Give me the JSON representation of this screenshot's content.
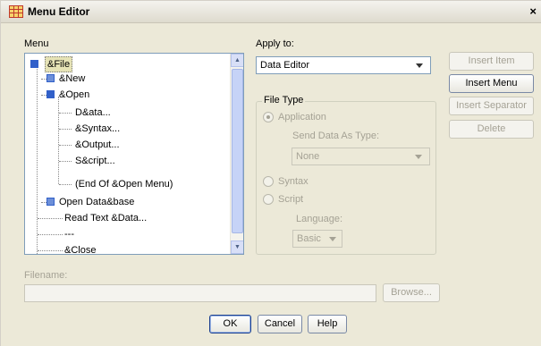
{
  "window": {
    "title": "Menu Editor",
    "close": "×"
  },
  "menu_label": "Menu",
  "tree": [
    {
      "label": "&File",
      "expander": "−",
      "selected": true
    },
    {
      "label": "&New",
      "expander": "+"
    },
    {
      "label": "&Open",
      "expander": "−"
    },
    {
      "label": "D&ata..."
    },
    {
      "label": "&Syntax..."
    },
    {
      "label": "&Output..."
    },
    {
      "label": "S&cript..."
    },
    {
      "label": "(End Of &Open Menu)"
    },
    {
      "label": "Open Data&base",
      "expander": "+"
    },
    {
      "label": "Read Text &Data..."
    },
    {
      "label": "---"
    },
    {
      "label": "&Close"
    }
  ],
  "apply_to": {
    "label": "Apply to:",
    "value": "Data Editor"
  },
  "file_type": {
    "title": "File Type",
    "application_label": "Application",
    "send_data_label": "Send Data As Type:",
    "send_data_value": "None",
    "syntax_label": "Syntax",
    "script_label": "Script",
    "language_label": "Language:",
    "language_value": "Basic"
  },
  "buttons": {
    "insert_item": "Insert Item",
    "insert_menu": "Insert Menu",
    "insert_separator": "Insert Separator",
    "delete": "Delete",
    "browse": "Browse...",
    "ok": "OK",
    "cancel": "Cancel",
    "help": "Help"
  },
  "filename": {
    "label": "Filename:",
    "value": ""
  }
}
